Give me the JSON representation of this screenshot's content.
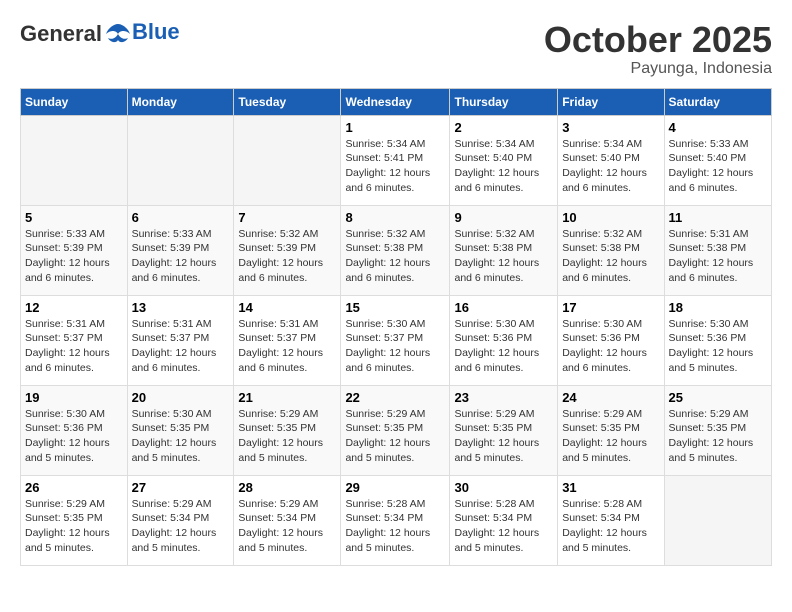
{
  "header": {
    "logo_general": "General",
    "logo_blue": "Blue",
    "month": "October 2025",
    "location": "Payunga, Indonesia"
  },
  "weekdays": [
    "Sunday",
    "Monday",
    "Tuesday",
    "Wednesday",
    "Thursday",
    "Friday",
    "Saturday"
  ],
  "weeks": [
    [
      {
        "day": "",
        "info": ""
      },
      {
        "day": "",
        "info": ""
      },
      {
        "day": "",
        "info": ""
      },
      {
        "day": "1",
        "info": "Sunrise: 5:34 AM\nSunset: 5:41 PM\nDaylight: 12 hours\nand 6 minutes."
      },
      {
        "day": "2",
        "info": "Sunrise: 5:34 AM\nSunset: 5:40 PM\nDaylight: 12 hours\nand 6 minutes."
      },
      {
        "day": "3",
        "info": "Sunrise: 5:34 AM\nSunset: 5:40 PM\nDaylight: 12 hours\nand 6 minutes."
      },
      {
        "day": "4",
        "info": "Sunrise: 5:33 AM\nSunset: 5:40 PM\nDaylight: 12 hours\nand 6 minutes."
      }
    ],
    [
      {
        "day": "5",
        "info": "Sunrise: 5:33 AM\nSunset: 5:39 PM\nDaylight: 12 hours\nand 6 minutes."
      },
      {
        "day": "6",
        "info": "Sunrise: 5:33 AM\nSunset: 5:39 PM\nDaylight: 12 hours\nand 6 minutes."
      },
      {
        "day": "7",
        "info": "Sunrise: 5:32 AM\nSunset: 5:39 PM\nDaylight: 12 hours\nand 6 minutes."
      },
      {
        "day": "8",
        "info": "Sunrise: 5:32 AM\nSunset: 5:38 PM\nDaylight: 12 hours\nand 6 minutes."
      },
      {
        "day": "9",
        "info": "Sunrise: 5:32 AM\nSunset: 5:38 PM\nDaylight: 12 hours\nand 6 minutes."
      },
      {
        "day": "10",
        "info": "Sunrise: 5:32 AM\nSunset: 5:38 PM\nDaylight: 12 hours\nand 6 minutes."
      },
      {
        "day": "11",
        "info": "Sunrise: 5:31 AM\nSunset: 5:38 PM\nDaylight: 12 hours\nand 6 minutes."
      }
    ],
    [
      {
        "day": "12",
        "info": "Sunrise: 5:31 AM\nSunset: 5:37 PM\nDaylight: 12 hours\nand 6 minutes."
      },
      {
        "day": "13",
        "info": "Sunrise: 5:31 AM\nSunset: 5:37 PM\nDaylight: 12 hours\nand 6 minutes."
      },
      {
        "day": "14",
        "info": "Sunrise: 5:31 AM\nSunset: 5:37 PM\nDaylight: 12 hours\nand 6 minutes."
      },
      {
        "day": "15",
        "info": "Sunrise: 5:30 AM\nSunset: 5:37 PM\nDaylight: 12 hours\nand 6 minutes."
      },
      {
        "day": "16",
        "info": "Sunrise: 5:30 AM\nSunset: 5:36 PM\nDaylight: 12 hours\nand 6 minutes."
      },
      {
        "day": "17",
        "info": "Sunrise: 5:30 AM\nSunset: 5:36 PM\nDaylight: 12 hours\nand 6 minutes."
      },
      {
        "day": "18",
        "info": "Sunrise: 5:30 AM\nSunset: 5:36 PM\nDaylight: 12 hours\nand 5 minutes."
      }
    ],
    [
      {
        "day": "19",
        "info": "Sunrise: 5:30 AM\nSunset: 5:36 PM\nDaylight: 12 hours\nand 5 minutes."
      },
      {
        "day": "20",
        "info": "Sunrise: 5:30 AM\nSunset: 5:35 PM\nDaylight: 12 hours\nand 5 minutes."
      },
      {
        "day": "21",
        "info": "Sunrise: 5:29 AM\nSunset: 5:35 PM\nDaylight: 12 hours\nand 5 minutes."
      },
      {
        "day": "22",
        "info": "Sunrise: 5:29 AM\nSunset: 5:35 PM\nDaylight: 12 hours\nand 5 minutes."
      },
      {
        "day": "23",
        "info": "Sunrise: 5:29 AM\nSunset: 5:35 PM\nDaylight: 12 hours\nand 5 minutes."
      },
      {
        "day": "24",
        "info": "Sunrise: 5:29 AM\nSunset: 5:35 PM\nDaylight: 12 hours\nand 5 minutes."
      },
      {
        "day": "25",
        "info": "Sunrise: 5:29 AM\nSunset: 5:35 PM\nDaylight: 12 hours\nand 5 minutes."
      }
    ],
    [
      {
        "day": "26",
        "info": "Sunrise: 5:29 AM\nSunset: 5:35 PM\nDaylight: 12 hours\nand 5 minutes."
      },
      {
        "day": "27",
        "info": "Sunrise: 5:29 AM\nSunset: 5:34 PM\nDaylight: 12 hours\nand 5 minutes."
      },
      {
        "day": "28",
        "info": "Sunrise: 5:29 AM\nSunset: 5:34 PM\nDaylight: 12 hours\nand 5 minutes."
      },
      {
        "day": "29",
        "info": "Sunrise: 5:28 AM\nSunset: 5:34 PM\nDaylight: 12 hours\nand 5 minutes."
      },
      {
        "day": "30",
        "info": "Sunrise: 5:28 AM\nSunset: 5:34 PM\nDaylight: 12 hours\nand 5 minutes."
      },
      {
        "day": "31",
        "info": "Sunrise: 5:28 AM\nSunset: 5:34 PM\nDaylight: 12 hours\nand 5 minutes."
      },
      {
        "day": "",
        "info": ""
      }
    ]
  ]
}
